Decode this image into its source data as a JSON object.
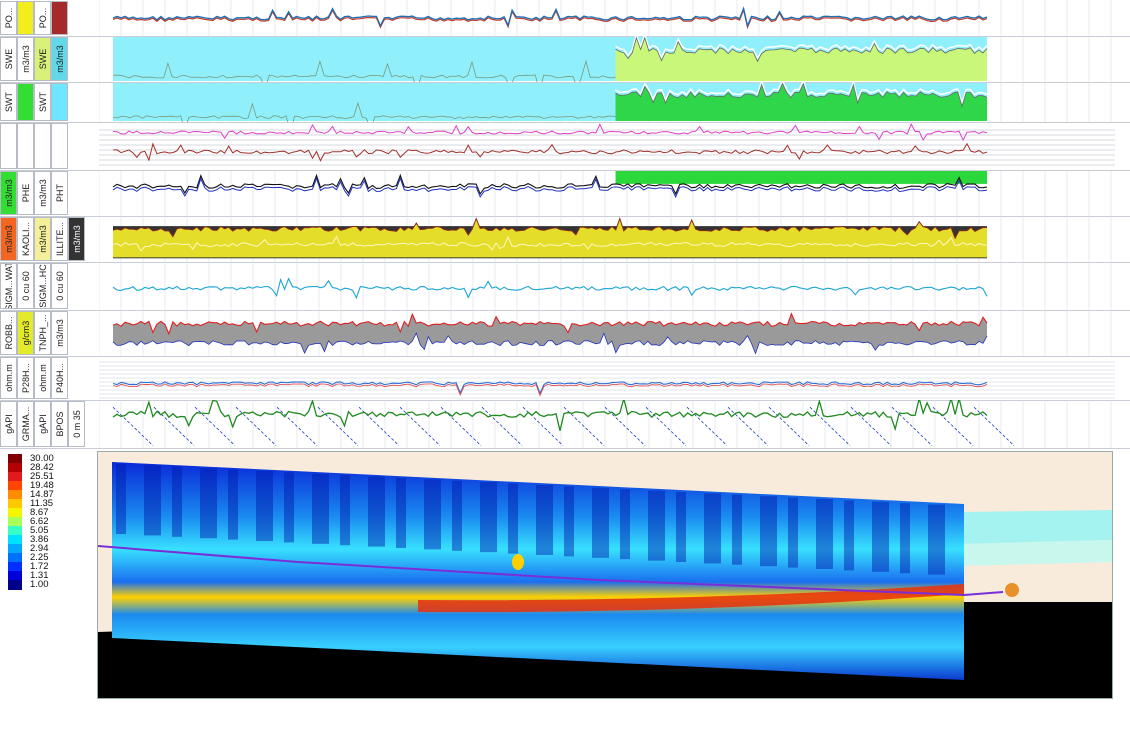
{
  "tracks": [
    {
      "id": "pore",
      "headers": [
        {
          "text": "PO...",
          "bg": "#ffffff"
        },
        {
          "text": "",
          "bg": "#f2ee1d"
        },
        {
          "text": "PO...",
          "bg": "#ffffff"
        },
        {
          "text": "",
          "bg": "#a52a2a"
        }
      ]
    },
    {
      "id": "swe",
      "headers": [
        {
          "text": "SWE",
          "bg": "#ffffff"
        },
        {
          "text": "m3/m3",
          "bg": "#ffffff"
        },
        {
          "text": "SWE",
          "bg": "#d9f17a"
        },
        {
          "text": "m3/m3",
          "bg": "#63d8e8"
        }
      ]
    },
    {
      "id": "swt",
      "headers": [
        {
          "text": "SWT",
          "bg": "#ffffff"
        },
        {
          "text": "",
          "bg": "#33dd33"
        },
        {
          "text": "SWT",
          "bg": "#ffffff"
        },
        {
          "text": "",
          "bg": "#6ee6ff"
        }
      ]
    },
    {
      "id": "blank",
      "headers": [
        {
          "text": "",
          "bg": "#ffffff"
        },
        {
          "text": "",
          "bg": "#ffffff"
        },
        {
          "text": "",
          "bg": "#ffffff"
        },
        {
          "text": "",
          "bg": "#ffffff"
        }
      ]
    },
    {
      "id": "phe",
      "headers": [
        {
          "text": "m3/m3",
          "bg": "#33dd33"
        },
        {
          "text": "PHE",
          "bg": "#ffffff"
        },
        {
          "text": "m3/m3",
          "bg": "#ffffff"
        },
        {
          "text": "PHT",
          "bg": "#ffffff"
        }
      ]
    },
    {
      "id": "kaol",
      "headers": [
        {
          "text": "m3/m3",
          "bg": "#f26522"
        },
        {
          "text": "KAOLI...",
          "bg": "#ffffff"
        },
        {
          "text": "m3/m3",
          "bg": "#f5ef9a"
        },
        {
          "text": "ILLITE...",
          "bg": "#ffffff"
        },
        {
          "text": "m3/m3",
          "bg": "#333333"
        }
      ]
    },
    {
      "id": "sigm",
      "headers": [
        {
          "text": "SIGM...WAT",
          "bg": "#ffffff"
        },
        {
          "text": "0   cu   60",
          "bg": "#ffffff"
        },
        {
          "text": "SIGM...HC",
          "bg": "#ffffff"
        },
        {
          "text": "0   cu   60",
          "bg": "#ffffff"
        }
      ]
    },
    {
      "id": "rob",
      "headers": [
        {
          "text": "ROBB...",
          "bg": "#ffffff"
        },
        {
          "text": "g/cm3",
          "bg": "#e3ea2a"
        },
        {
          "text": "TNPH_...",
          "bg": "#ffffff"
        },
        {
          "text": "m3/m3",
          "bg": "#ffffff"
        }
      ]
    },
    {
      "id": "p28h",
      "headers": [
        {
          "text": "ohm.m",
          "bg": "#ffffff"
        },
        {
          "text": "P28H...",
          "bg": "#ffffff"
        },
        {
          "text": "ohm.m",
          "bg": "#ffffff"
        },
        {
          "text": "P40H...",
          "bg": "#ffffff"
        }
      ]
    },
    {
      "id": "gr",
      "headers": [
        {
          "text": "gAPI",
          "bg": "#ffffff"
        },
        {
          "text": "GRMA...",
          "bg": "#ffffff"
        },
        {
          "text": "gAPI",
          "bg": "#ffffff"
        },
        {
          "text": "BPOS",
          "bg": "#ffffff"
        },
        {
          "text": "0   m   35",
          "bg": "#ffffff"
        }
      ]
    }
  ],
  "colorbar": {
    "labels": [
      "30.00",
      "28.42",
      "25.51",
      "19.48",
      "14.87",
      "11.35",
      "8.67",
      "6.62",
      "5.05",
      "3.86",
      "2.94",
      "2.25",
      "1.72",
      "1.31",
      "1.00"
    ],
    "colors": [
      "#7f0000",
      "#b30000",
      "#e31a1c",
      "#ff4500",
      "#ff8c00",
      "#ffc800",
      "#f5f500",
      "#a8ff58",
      "#38ffc5",
      "#00e0ff",
      "#00a8ff",
      "#0070ff",
      "#0030ff",
      "#0000d8",
      "#00008a"
    ]
  },
  "section": {
    "layers": {
      "top": "#f9ebdb",
      "cyan": "#a4f3f0",
      "aqua": "#c8f7ee",
      "bottom": "#000000"
    },
    "well_color": "#7a2ed8",
    "marker_color": "#e8902a"
  }
}
